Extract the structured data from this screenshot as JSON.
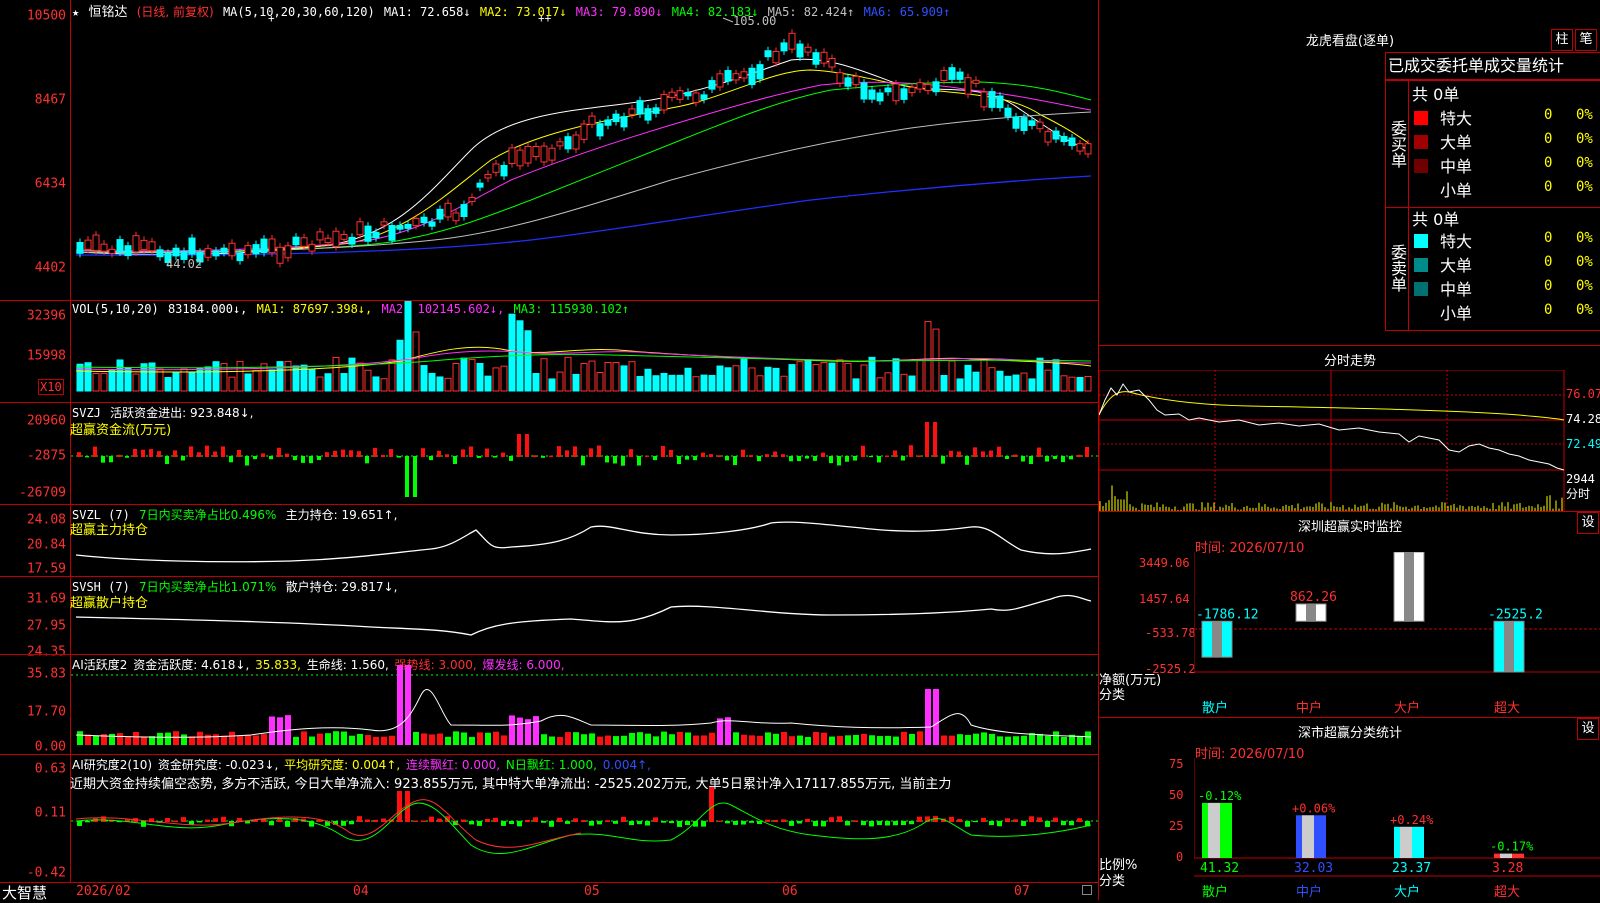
{
  "app": {
    "name": "大智慧"
  },
  "stock": {
    "star": "★",
    "name": "恒铭达",
    "mode": "(日线, 前复权)"
  },
  "price_panel": {
    "ma_title": "MA(5,10,20,30,60,120)",
    "ma": [
      {
        "label": "MA1: 72.658↓",
        "color": "#ffffff"
      },
      {
        "label": "MA2: 73.017↓",
        "color": "#ffff00"
      },
      {
        "label": "MA3: 79.890↓",
        "color": "#ff30ff"
      },
      {
        "label": "MA4: 82.183↓",
        "color": "#00ff00"
      },
      {
        "label": "MA5: 82.424↑",
        "color": "#c0c0c0"
      },
      {
        "label": "MA6: 65.909↑",
        "color": "#3050ff"
      }
    ],
    "yticks": [
      "10500",
      "8467",
      "6434",
      "4402"
    ],
    "high_label": "105.00",
    "low_label": "44.02"
  },
  "vol_panel": {
    "title": "VOL(5,10,20)",
    "value": "83184.000↓,",
    "ma1": "MA1: 87697.398↓,",
    "ma2": "MA2: 102145.602↓,",
    "ma3": "MA3: 115930.102↑",
    "yticks": [
      "32396",
      "15998"
    ],
    "unit": "X10"
  },
  "svzj_panel": {
    "title": "SVZJ",
    "label": "活跃资金进出: 923.848↓,",
    "sub": "超赢资金流(万元)",
    "yticks": [
      "20960",
      "-2875",
      "-26709"
    ]
  },
  "svzl_panel": {
    "title": "SVZL (7)",
    "label1": "7日内买卖净占比0.496%",
    "label2": "主力持仓: 19.651↑,",
    "sub": "超赢主力持仓",
    "yticks": [
      "24.08",
      "20.84",
      "17.59"
    ]
  },
  "svsh_panel": {
    "title": "SVSH (7)",
    "label1": "7日内买卖净占比1.071%",
    "label2": "散户持仓: 29.817↓,",
    "sub": "超赢散户持仓",
    "yticks": [
      "31.69",
      "27.95",
      "24.35"
    ]
  },
  "ai1_panel": {
    "title": "AI活跃度2",
    "l1": "资金活跃度: 4.618↓,",
    "l2": "35.833,",
    "l3": "生命线: 1.560,",
    "l4": "强势线: 3.000,",
    "l5": "爆发线: 6.000,",
    "yticks": [
      "35.83",
      "17.70",
      "0.00"
    ]
  },
  "ai2_panel": {
    "title": "AI研究度2(10)",
    "l1": "资金研究度: -0.023↓,",
    "l2": "平均研究度: 0.004↑,",
    "l3": "连续飘红: 0.000,",
    "l4": "N日飘红: 1.000,",
    "l5": "0.004↑,",
    "desc": "近期大资金持续偏空态势, 多方不活跃, 今日大单净流入: 923.855万元, 其中特大单净流出: -2525.202万元, 大单5日累计净入17117.855万元, 当前主力",
    "yticks": [
      "0.63",
      "0.11",
      "-0.42"
    ]
  },
  "date_axis": [
    "2026/02",
    "04",
    "05",
    "06",
    "07"
  ],
  "right": {
    "lhb_title": "龙虎看盘(逐单)",
    "btn_zhu": "柱",
    "btn_bi": "笔",
    "tab_title": "已成交委托单成交量统计",
    "buy_side": {
      "label": "委买单",
      "total": "共 0单",
      "rows": [
        {
          "name": "特大",
          "count": "0",
          "pct": "0%",
          "color": "#ff0000"
        },
        {
          "name": "大单",
          "count": "0",
          "pct": "0%",
          "color": "#a00000"
        },
        {
          "name": "中单",
          "count": "0",
          "pct": "0%",
          "color": "#700000"
        },
        {
          "name": "小单",
          "count": "0",
          "pct": "0%",
          "color": ""
        }
      ]
    },
    "sell_side": {
      "label": "委卖单",
      "total": "共 0单",
      "rows": [
        {
          "name": "特大",
          "count": "0",
          "pct": "0%",
          "color": "#00ffff"
        },
        {
          "name": "大单",
          "count": "0",
          "pct": "0%",
          "color": "#008b8b"
        },
        {
          "name": "中单",
          "count": "0",
          "pct": "0%",
          "color": "#007070"
        },
        {
          "name": "小单",
          "count": "0",
          "pct": "0%",
          "color": ""
        }
      ]
    },
    "intraday": {
      "title": "分时走势",
      "yticks": [
        "76.07",
        "74.28",
        "72.49"
      ],
      "vol_label": "2944",
      "vol_unit": "分时"
    },
    "monitor": {
      "title": "深圳超赢实时监控",
      "btn": "设",
      "time": "时间: 2026/07/10",
      "yticks": [
        "3449.06",
        "1457.64",
        "-533.78",
        "-2525.2"
      ],
      "ylabel1": "净额(万元)",
      "ylabel2": "分类",
      "categories": [
        "散户",
        "中户",
        "大户",
        "超大"
      ],
      "values": [
        "-1786.12",
        "862.26",
        "3449.06",
        "-2525.2"
      ]
    },
    "classify": {
      "title": "深市超赢分类统计",
      "btn": "设",
      "time": "时间: 2026/07/10",
      "yticks": [
        "75",
        "50",
        "25",
        "0"
      ],
      "ylabel1": "比例%",
      "ylabel2": "分类",
      "categories": [
        "散户",
        "中户",
        "大户",
        "超大"
      ],
      "changes": [
        "-0.12%",
        "+0.06%",
        "+0.24%",
        "-0.17%"
      ],
      "values": [
        "41.32",
        "32.03",
        "23.37",
        "3.28"
      ]
    }
  }
}
